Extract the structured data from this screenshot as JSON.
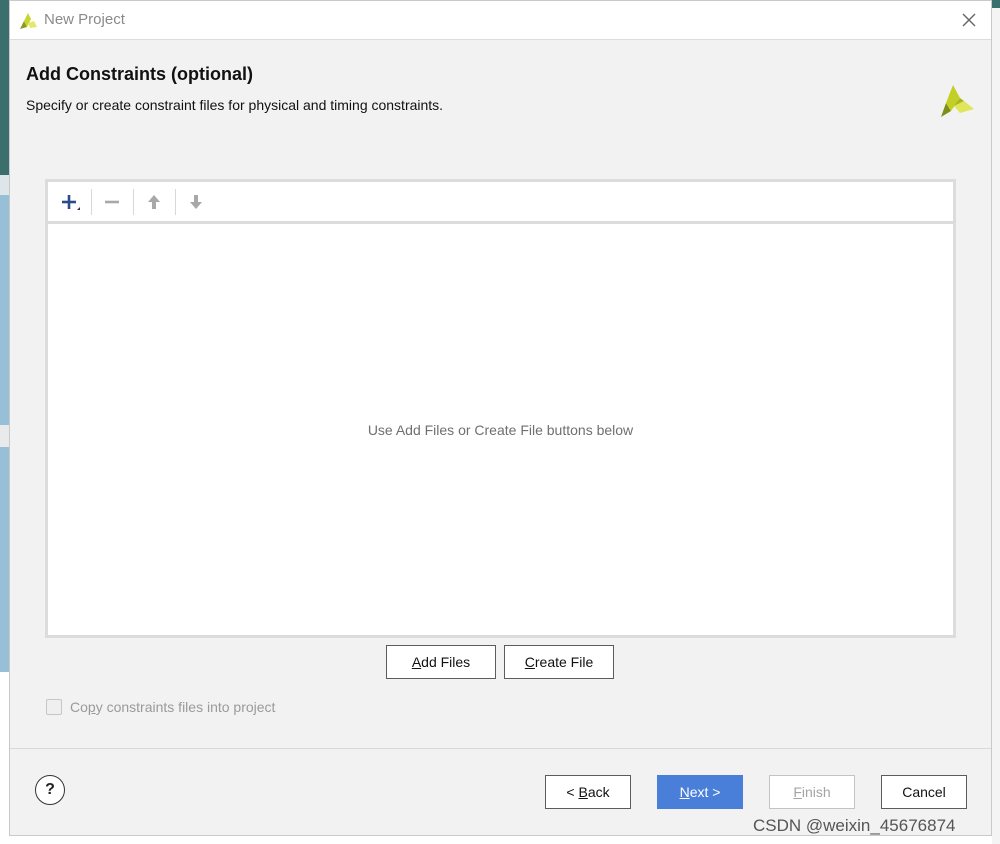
{
  "window": {
    "title": "New Project",
    "logo_icon": "xilinx-logo-icon",
    "close_icon": "close-icon"
  },
  "header": {
    "title": "Add Constraints (optional)",
    "description": "Specify or create constraint files for physical and timing constraints."
  },
  "toolbar": {
    "items": [
      {
        "name": "add-icon",
        "enabled": true
      },
      {
        "name": "remove-icon",
        "enabled": false
      },
      {
        "name": "move-up-icon",
        "enabled": false
      },
      {
        "name": "move-down-icon",
        "enabled": false
      }
    ]
  },
  "file_list": {
    "empty_message": "Use Add Files or Create File buttons below"
  },
  "actions": {
    "add_files": {
      "mnemonic": "A",
      "rest": "dd Files"
    },
    "create_file": {
      "mnemonic": "C",
      "rest": "reate File"
    }
  },
  "options": {
    "copy_constraints": {
      "label_pre": "Co",
      "mnemonic": "p",
      "label_post": "y constraints files into project",
      "checked": false,
      "enabled": false
    }
  },
  "footer": {
    "help_label": "?",
    "back": {
      "pre": "< ",
      "mnemonic": "B",
      "rest": "ack"
    },
    "next": {
      "mnemonic": "N",
      "rest": "ext >"
    },
    "finish": {
      "mnemonic": "F",
      "rest": "inish",
      "enabled": false
    },
    "cancel": {
      "label": "Cancel"
    }
  },
  "watermark": "CSDN @weixin_45676874",
  "colors": {
    "primary_button": "#4a7fd9",
    "logo_green": "#8a9a1f",
    "logo_yellow": "#d6e03c"
  }
}
